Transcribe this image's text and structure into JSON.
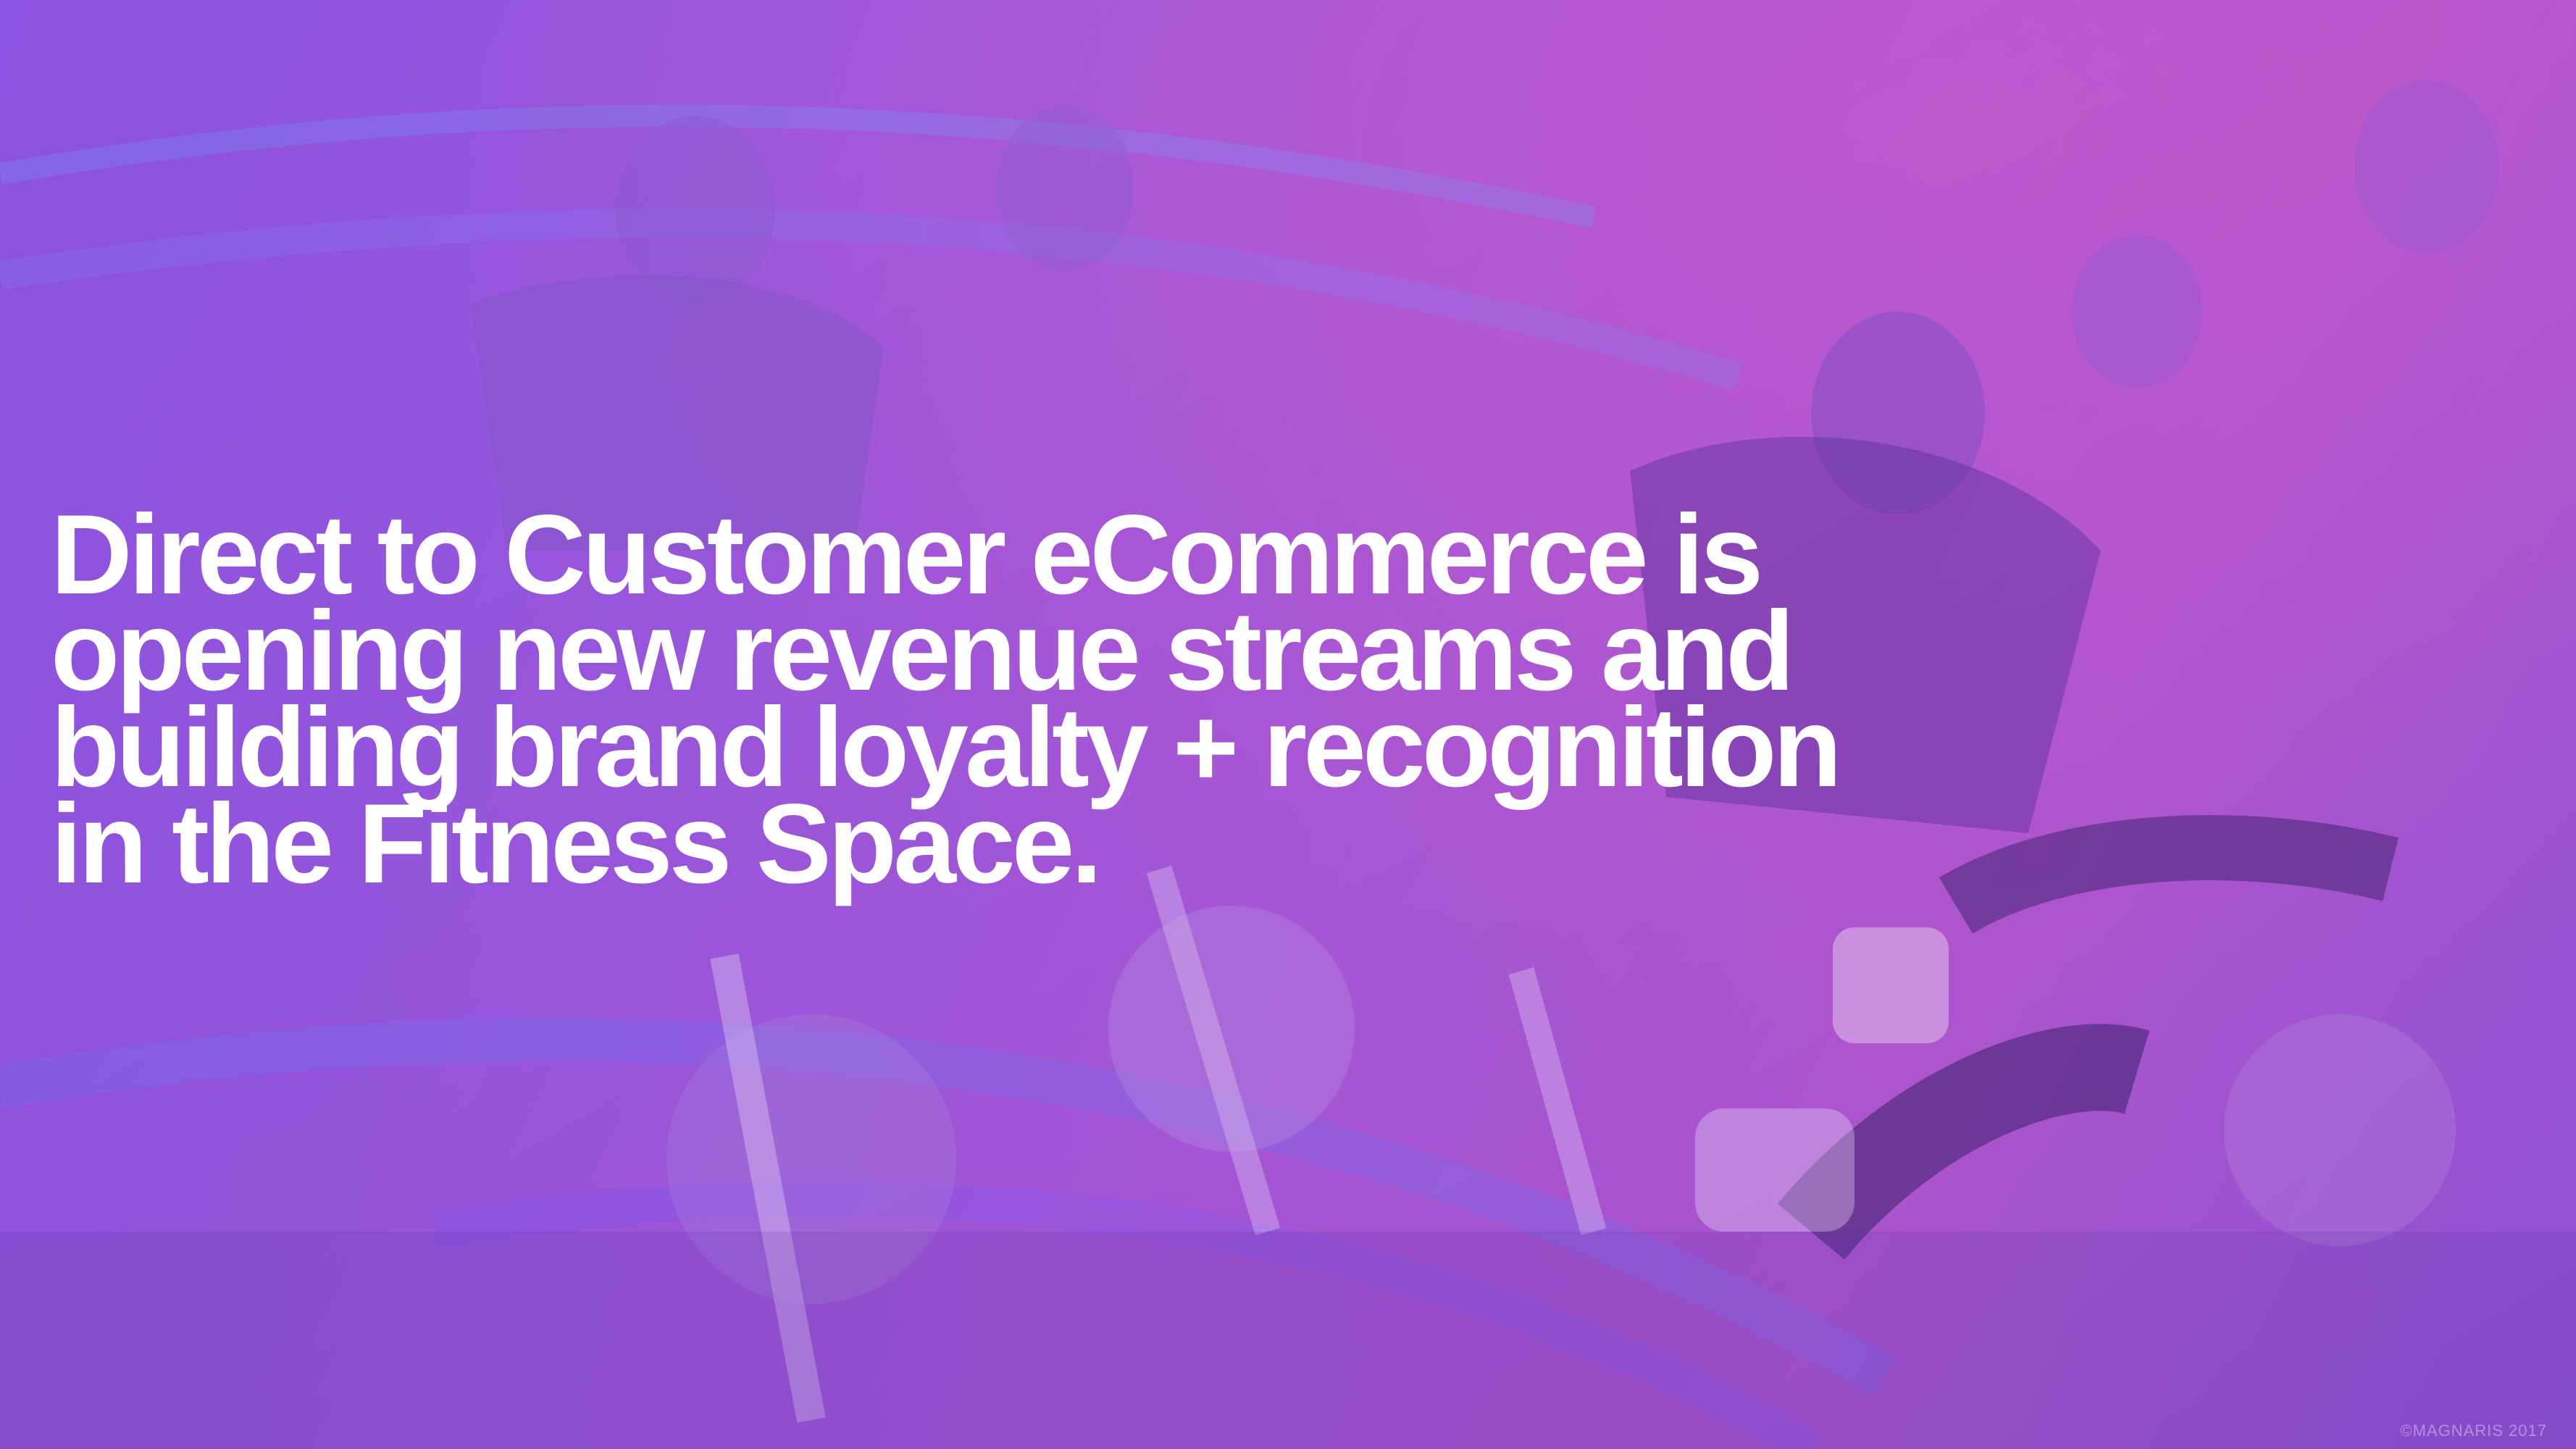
{
  "slide": {
    "headline_lines": [
      "Direct to Customer eCommerce is",
      "opening new revenue streams and",
      "building brand loyalty + recognition",
      "in the Fitness Space."
    ],
    "photo_credit": "©MAGNARIS 2017"
  },
  "colors": {
    "overlay_purple": "#9a56dc",
    "overlay_magenta": "#c25ccf",
    "text": "#ffffff"
  }
}
